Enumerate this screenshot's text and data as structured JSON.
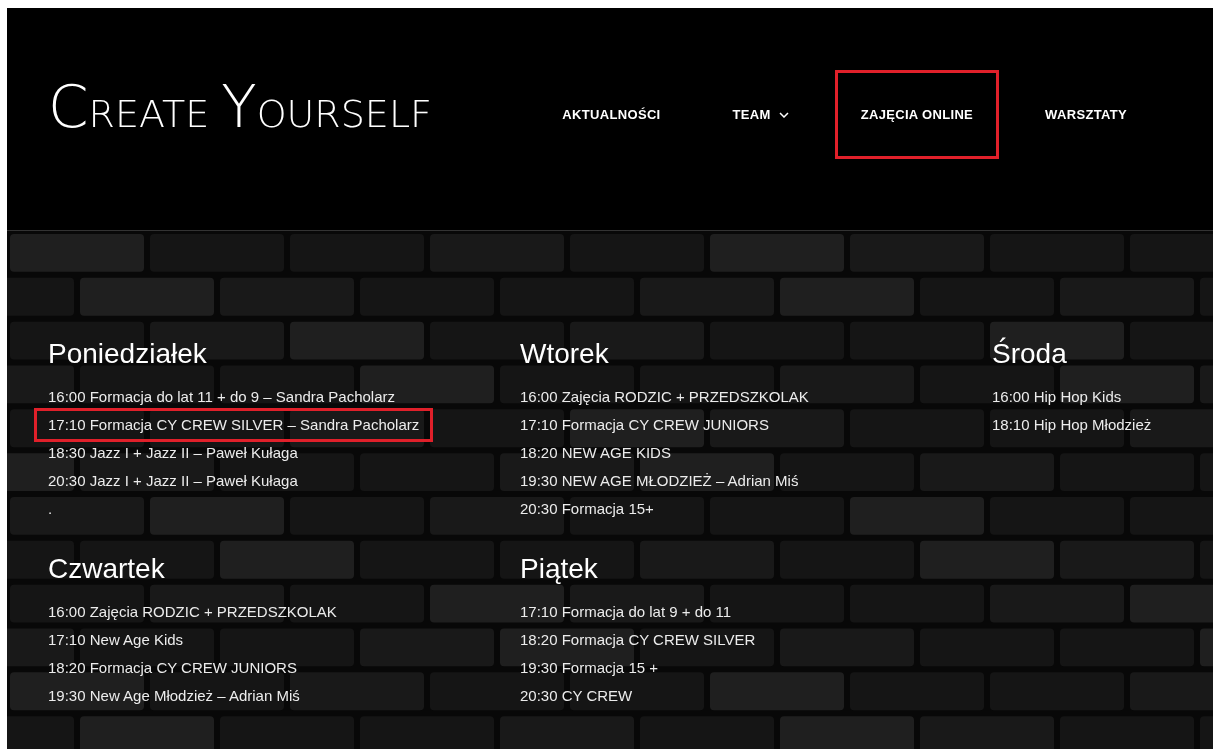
{
  "header": {
    "logo": "CREATE YOURSELF",
    "nav": [
      {
        "label": "AKTUALNOŚCI",
        "dropdown": false,
        "highlighted": false
      },
      {
        "label": "TEAM",
        "dropdown": true,
        "highlighted": false
      },
      {
        "label": "ZAJĘCIA ONLINE",
        "dropdown": false,
        "highlighted": true
      },
      {
        "label": "WARSZTATY",
        "dropdown": false,
        "highlighted": false
      }
    ]
  },
  "schedule": [
    {
      "day": "Poniedziałek",
      "entries": [
        {
          "text": "16:00 Formacja do lat 11 + do 9 – Sandra Pacholarz",
          "highlighted": false
        },
        {
          "text": "17:10 Formacja CY CREW SILVER – Sandra Pacholarz",
          "highlighted": true
        },
        {
          "text": "18:30 Jazz I + Jazz II – Paweł Kułaga",
          "highlighted": false
        },
        {
          "text": "20:30 Jazz I + Jazz II – Paweł Kułaga",
          "highlighted": false
        },
        {
          "text": ".",
          "highlighted": false
        }
      ]
    },
    {
      "day": "Wtorek",
      "entries": [
        {
          "text": "16:00 Zajęcia RODZIC + PRZEDSZKOLAK",
          "highlighted": false
        },
        {
          "text": "17:10 Formacja CY CREW JUNIORS",
          "highlighted": false
        },
        {
          "text": "18:20 NEW AGE KIDS",
          "highlighted": false
        },
        {
          "text": "19:30 NEW AGE MŁODZIEŻ – Adrian Miś",
          "highlighted": false
        },
        {
          "text": "20:30 Formacja 15+",
          "highlighted": false
        }
      ]
    },
    {
      "day": "Środa",
      "entries": [
        {
          "text": "16:00 Hip Hop Kids",
          "highlighted": false
        },
        {
          "text": "18:10 Hip Hop Młodzież",
          "highlighted": false
        }
      ]
    },
    {
      "day": "Czwartek",
      "entries": [
        {
          "text": "16:00 Zajęcia RODZIC + PRZEDSZKOLAK",
          "highlighted": false
        },
        {
          "text": "17:10 New Age Kids",
          "highlighted": false
        },
        {
          "text": "18:20 Formacja CY CREW JUNIORS",
          "highlighted": false
        },
        {
          "text": "19:30 New Age Młodzież – Adrian Miś",
          "highlighted": false
        }
      ]
    },
    {
      "day": "Piątek",
      "entries": [
        {
          "text": "17:10 Formacja do lat 9 + do 11",
          "highlighted": false
        },
        {
          "text": "18:20 Formacja CY CREW SILVER",
          "highlighted": false
        },
        {
          "text": "19:30 Formacja 15 +",
          "highlighted": false
        },
        {
          "text": "20:30 CY CREW",
          "highlighted": false
        }
      ]
    }
  ]
}
